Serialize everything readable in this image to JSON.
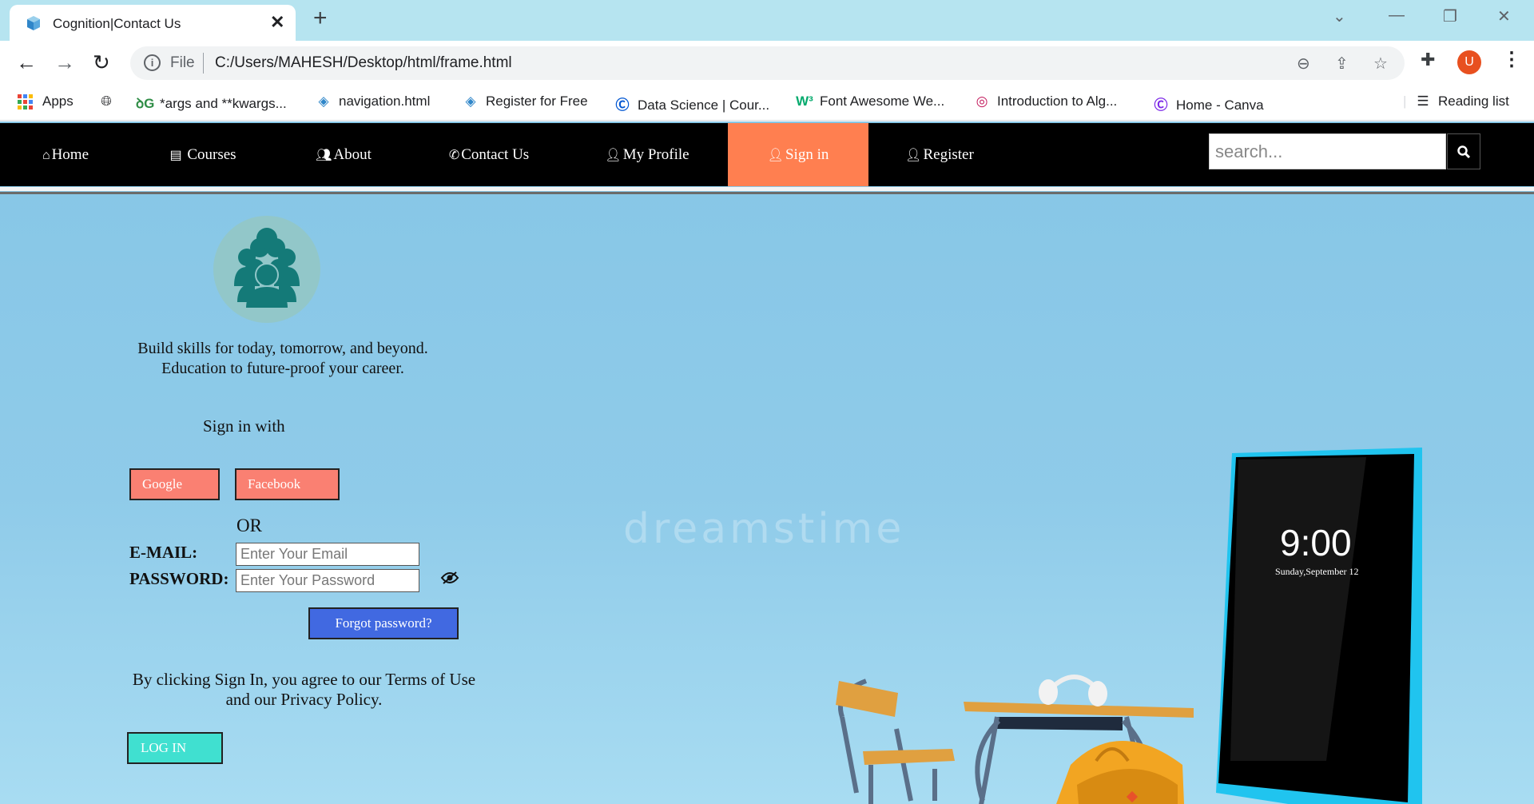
{
  "browser": {
    "tab_title": "Cognition|Contact Us",
    "url_scheme": "File",
    "url": "C:/Users/MAHESH/Desktop/html/frame.html",
    "profile_initial": "U",
    "bookmarks": [
      {
        "label": "Apps",
        "icon": "apps-grid-icon"
      },
      {
        "label": "",
        "icon": "globe-icon"
      },
      {
        "label": "*args and **kwargs...",
        "icon": "geeksforgeeks-icon"
      },
      {
        "label": "navigation.html",
        "icon": "file-cube-icon"
      },
      {
        "label": "Register for Free",
        "icon": "file-cube-icon"
      },
      {
        "label": "Data Science | Cour...",
        "icon": "coursera-icon"
      },
      {
        "label": "Font Awesome We...",
        "icon": "w3schools-icon"
      },
      {
        "label": "Introduction to Alg...",
        "icon": "fingerprint-icon"
      },
      {
        "label": "Home - Canva",
        "icon": "canva-icon"
      }
    ],
    "reading_list_label": "Reading list"
  },
  "nav": {
    "items": [
      {
        "label": "Home",
        "icon": "home-icon"
      },
      {
        "label": "Courses",
        "icon": "book-icon"
      },
      {
        "label": "About",
        "icon": "users-icon"
      },
      {
        "label": "Contact Us",
        "icon": "phone-icon"
      },
      {
        "label": "My Profile",
        "icon": "user-icon"
      },
      {
        "label": "Sign in",
        "icon": "user-plus-icon",
        "active": true
      },
      {
        "label": "Register",
        "icon": "user-icon"
      }
    ],
    "search_placeholder": "search...",
    "active_color": "#ff7f50"
  },
  "signin": {
    "tagline_line1": "Build skills for today, tomorrow, and beyond.",
    "tagline_line2": "Education to future-proof your career.",
    "sign_in_with": "Sign in with",
    "google_label": "Google",
    "facebook_label": "Facebook",
    "or_label": "OR",
    "email_label": "E-MAIL:",
    "email_placeholder": "Enter Your Email",
    "password_label": "PASSWORD:",
    "password_placeholder": "Enter Your Password",
    "forgot_label": "Forgot password?",
    "terms_line1": "By clicking Sign In, you agree to our Terms of Use",
    "terms_line2": "and our Privacy Policy.",
    "login_label": "LOG IN"
  },
  "hero": {
    "watermark": "dreamstime",
    "phone_time": "9:00",
    "phone_date": "Sunday,September 12"
  }
}
